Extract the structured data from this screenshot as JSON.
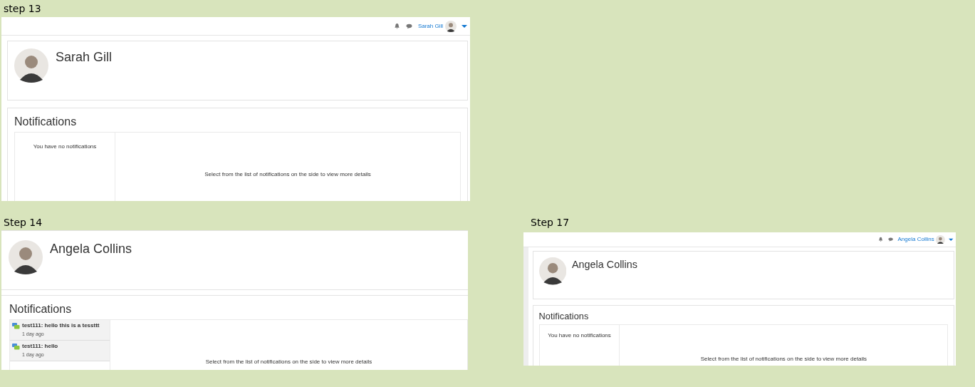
{
  "panels": [
    {
      "label": "step 13",
      "navbar": {
        "user": "Sarah Gill"
      },
      "profile": {
        "name": "Sarah Gill"
      },
      "notifications": {
        "heading": "Notifications",
        "empty_message": "You have no notifications",
        "detail_hint": "Select from the list of notifications on the side to view more details"
      }
    },
    {
      "label": "Step 14",
      "profile": {
        "name": "Angela Collins"
      },
      "notifications": {
        "heading": "Notifications",
        "items": [
          {
            "title": "test111: hello this is a tessttt",
            "time": "1 day ago"
          },
          {
            "title": "test111: hello",
            "time": "1 day ago"
          }
        ],
        "detail_hint": "Select from the list of notifications on the side to view more details"
      }
    },
    {
      "label": "Step 17",
      "navbar": {
        "user": "Angela Collins"
      },
      "profile": {
        "name": "Angela Collins"
      },
      "notifications": {
        "heading": "Notifications",
        "empty_message": "You have no notifications",
        "detail_hint": "Select from the list of notifications on the side to view more details"
      }
    }
  ]
}
